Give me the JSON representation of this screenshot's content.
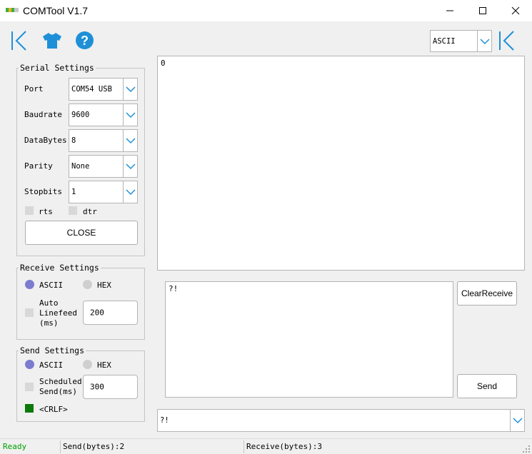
{
  "window": {
    "title": "COMTool V1.7"
  },
  "toolbar": {
    "encoding": {
      "selected": "ASCII"
    }
  },
  "colors": {
    "accent": "#1e90d8",
    "radio_selected": "#7b7bd0",
    "crlf": "#0b7a0b",
    "ready": "#00a000"
  },
  "serial_settings": {
    "title": "Serial Settings",
    "port": {
      "label": "Port",
      "value": "COM54 USB"
    },
    "baudrate": {
      "label": "Baudrate",
      "value": "9600"
    },
    "databytes": {
      "label": "DataBytes",
      "value": "8"
    },
    "parity": {
      "label": "Parity",
      "value": "None"
    },
    "stopbits": {
      "label": "Stopbits",
      "value": "1"
    },
    "rts": "rts",
    "dtr": "dtr",
    "close": "CLOSE"
  },
  "receive_settings": {
    "title": "Receive Settings",
    "ascii": "ASCII",
    "hex": "HEX",
    "auto_linefeed_1": "Auto",
    "auto_linefeed_2": "Linefeed",
    "auto_linefeed_3": "(ms)",
    "linefeed_ms": "200"
  },
  "send_settings": {
    "title": "Send Settings",
    "ascii": "ASCII",
    "hex": "HEX",
    "scheduled_1": "Scheduled",
    "scheduled_2": "Send(ms)",
    "scheduled_ms": "300",
    "crlf": "<CRLF>"
  },
  "receive_area": {
    "content": "0"
  },
  "send_area": {
    "content": "?!"
  },
  "buttons": {
    "clear_receive": "ClearReceive",
    "send": "Send"
  },
  "history": {
    "value": "?!"
  },
  "status": {
    "ready": "Ready",
    "sent": "Send(bytes):2",
    "received": "Receive(bytes):3"
  }
}
